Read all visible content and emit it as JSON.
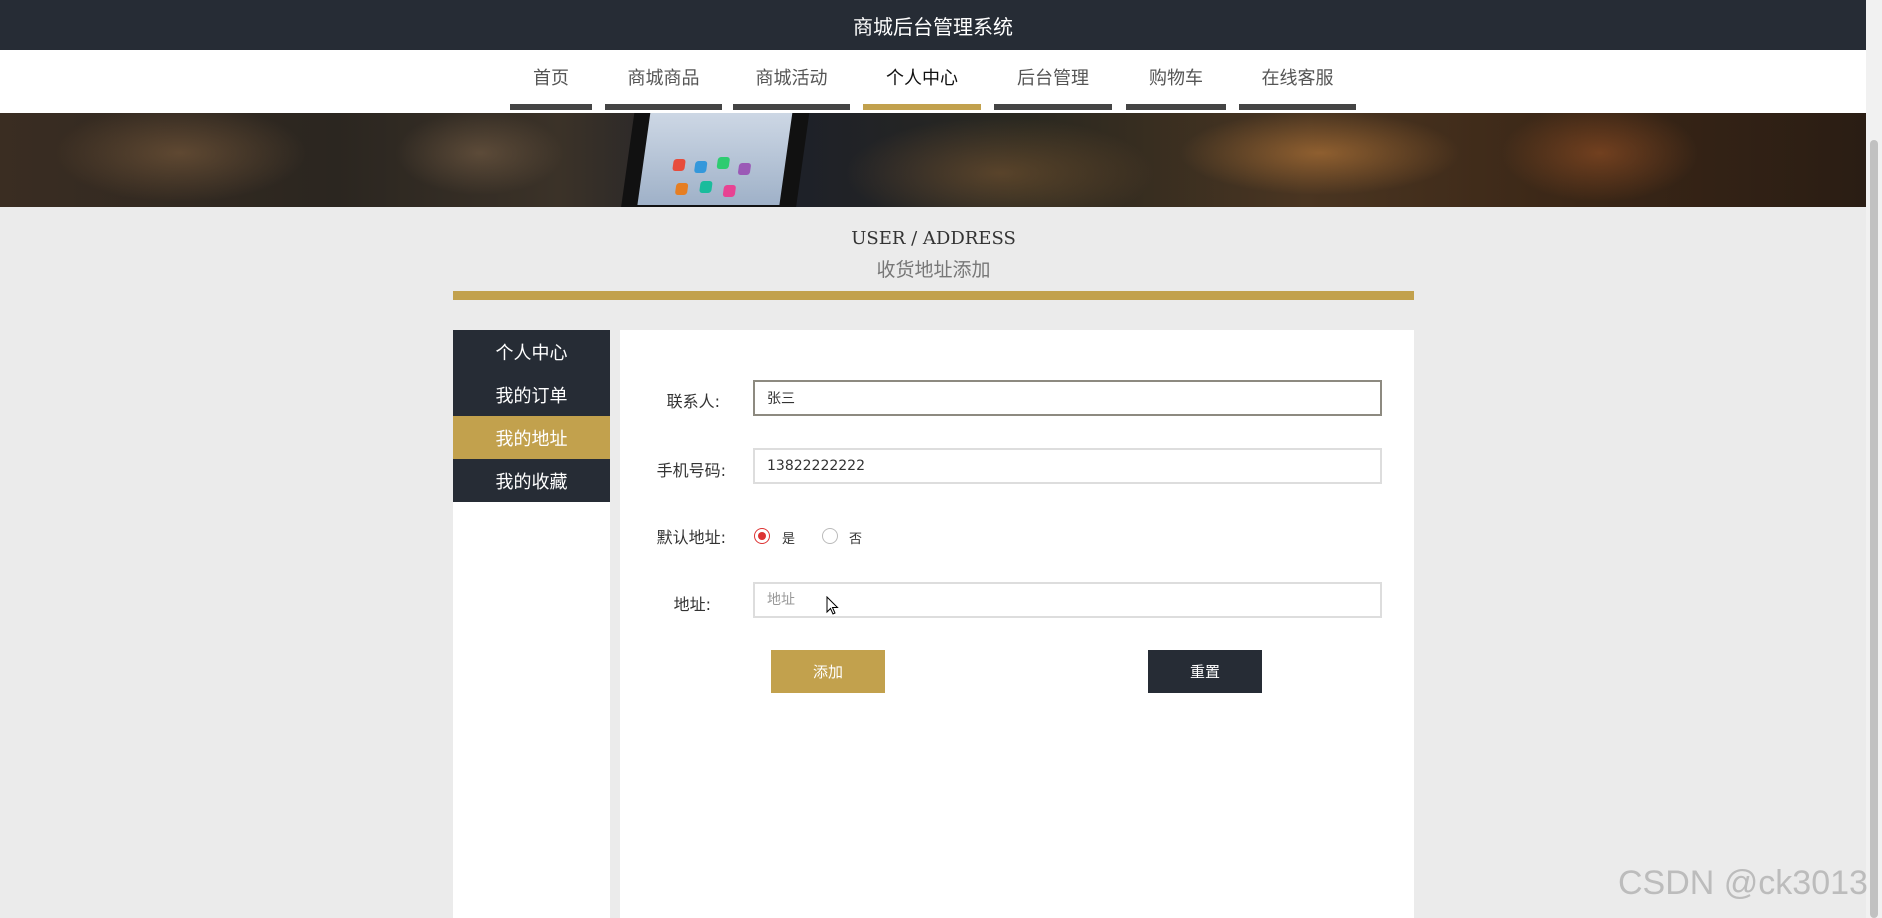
{
  "header": {
    "title": "商城后台管理系统"
  },
  "nav": {
    "items": [
      {
        "label": "首页"
      },
      {
        "label": "商城商品"
      },
      {
        "label": "商城活动"
      },
      {
        "label": "个人中心"
      },
      {
        "label": "后台管理"
      },
      {
        "label": "购物车"
      },
      {
        "label": "在线客服"
      }
    ],
    "active": "个人中心"
  },
  "page": {
    "title_en": "USER / ADDRESS",
    "title_cn": "收货地址添加"
  },
  "sidebar": {
    "items": [
      {
        "label": "个人中心"
      },
      {
        "label": "我的订单"
      },
      {
        "label": "我的地址"
      },
      {
        "label": "我的收藏"
      }
    ],
    "active": "我的地址"
  },
  "form": {
    "contact_label": "联系人:",
    "contact_value": "张三",
    "phone_label": "手机号码:",
    "phone_value": "13822222222",
    "default_label": "默认地址:",
    "default_yes": "是",
    "default_no": "否",
    "default_selected": "是",
    "address_label": "地址:",
    "address_placeholder": "地址",
    "address_value": "",
    "add_button": "添加",
    "reset_button": "重置"
  },
  "watermark": "CSDN @ck3013",
  "colors": {
    "dark": "#262c35",
    "accent": "#c2a14d",
    "radio_checked": "#dd3333",
    "background": "#ebebeb"
  }
}
